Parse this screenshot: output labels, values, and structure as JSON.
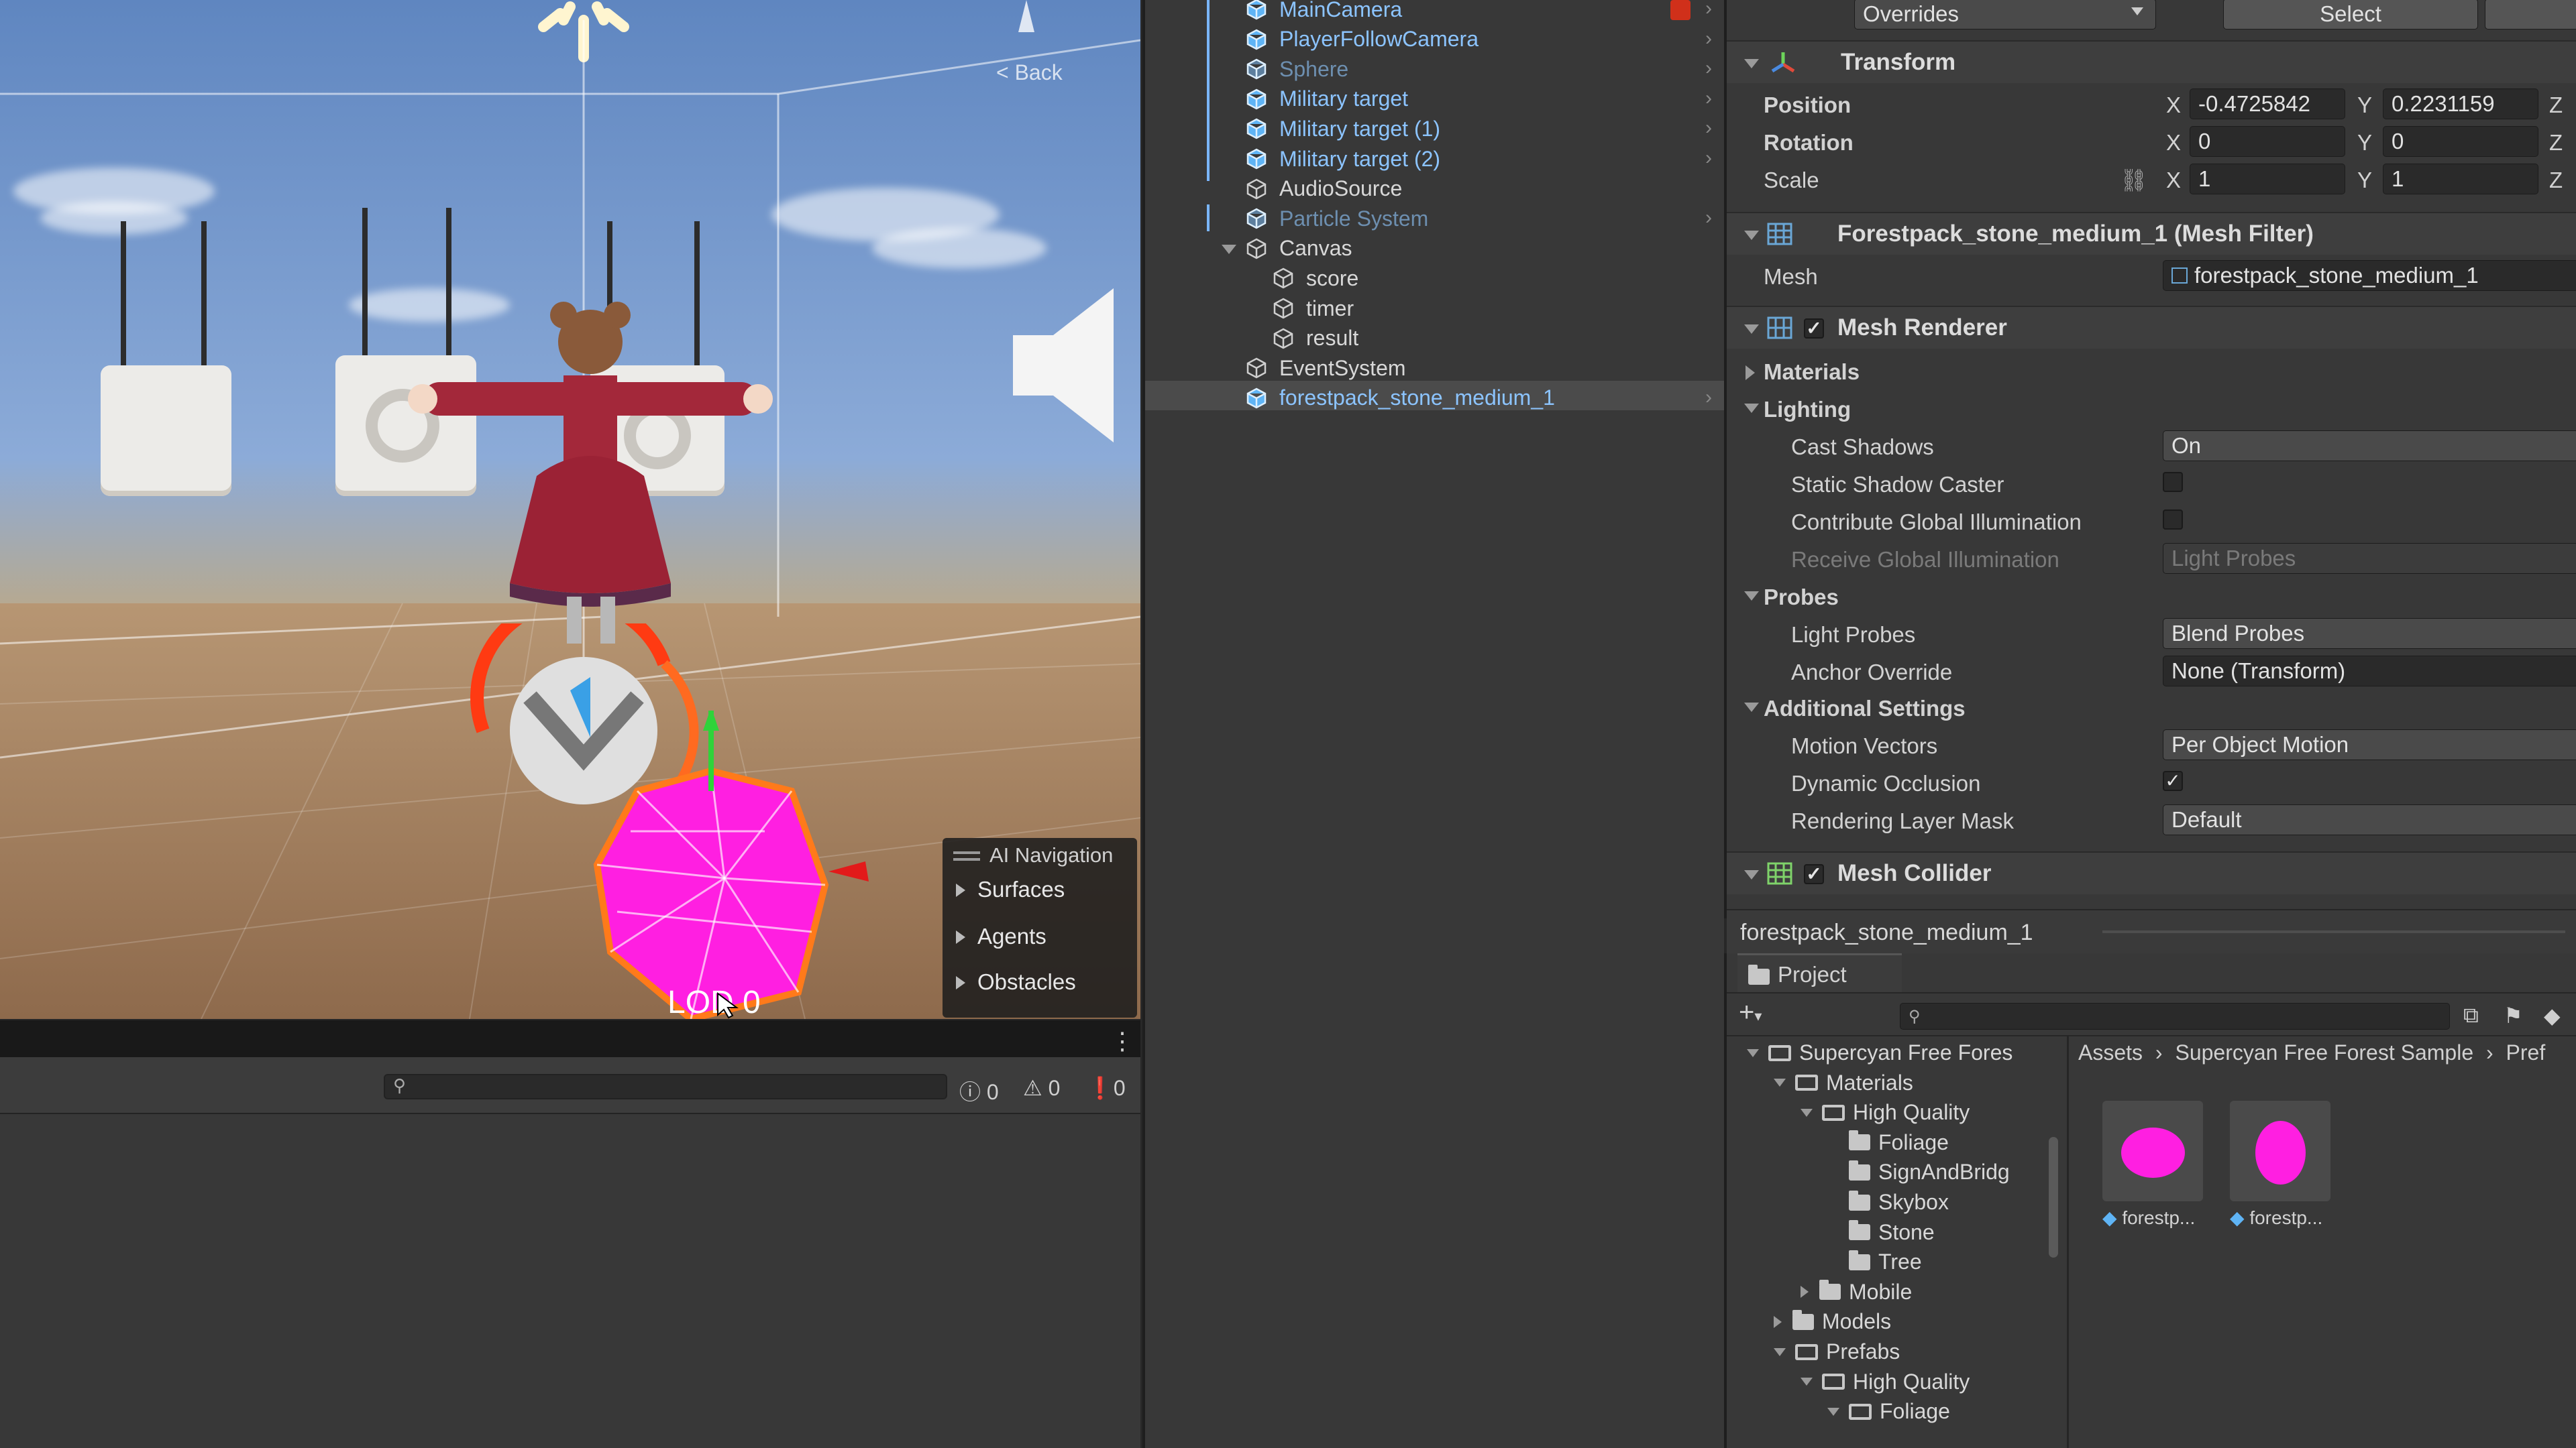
{
  "scene": {
    "back_label": "< Back",
    "lod_label": "LOD 0",
    "ai_nav": {
      "title": "AI Navigation",
      "items": [
        "Surfaces",
        "Agents",
        "Obstacles"
      ]
    }
  },
  "console": {
    "search_placeholder": "",
    "log_count": "0",
    "warning_count": "0",
    "error_count": "0"
  },
  "hierarchy": {
    "items": [
      {
        "label": "MainCamera",
        "style": "prefab"
      },
      {
        "label": "PlayerFollowCamera",
        "style": "prefab"
      },
      {
        "label": "Sphere",
        "style": "prefab-disabled"
      },
      {
        "label": "Military target",
        "style": "prefab"
      },
      {
        "label": "Military target (1)",
        "style": "prefab"
      },
      {
        "label": "Military target (2)",
        "style": "prefab"
      },
      {
        "label": "AudioSource",
        "style": "object"
      },
      {
        "label": "Particle System",
        "style": "prefab-disabled"
      },
      {
        "label": "Canvas",
        "style": "object"
      },
      {
        "label": "score",
        "style": "object"
      },
      {
        "label": "timer",
        "style": "object"
      },
      {
        "label": "result",
        "style": "object"
      },
      {
        "label": "EventSystem",
        "style": "object"
      },
      {
        "label": "forestpack_stone_medium_1",
        "style": "prefab"
      }
    ]
  },
  "inspector": {
    "overrides_label": "Overrides",
    "select_label": "Select",
    "transform": {
      "title": "Transform",
      "position_label": "Position",
      "rotation_label": "Rotation",
      "scale_label": "Scale",
      "axis_x": "X",
      "axis_y": "Y",
      "axis_z": "Z",
      "position_x": "-0.4725842",
      "position_y": "0.2231159",
      "rotation_x": "0",
      "rotation_y": "0",
      "scale_x": "1",
      "scale_y": "1"
    },
    "mesh_filter": {
      "title": "Forestpack_stone_medium_1 (Mesh Filter)",
      "mesh_label": "Mesh",
      "mesh_value": "forestpack_stone_medium_1"
    },
    "mesh_renderer": {
      "title": "Mesh Renderer",
      "materials_label": "Materials",
      "lighting_label": "Lighting",
      "cast_shadows_label": "Cast Shadows",
      "cast_shadows_value": "On",
      "static_shadow_label": "Static Shadow Caster",
      "contribute_gi_label": "Contribute Global Illumination",
      "receive_gi_label": "Receive Global Illumination",
      "receive_gi_value": "Light Probes",
      "probes_label": "Probes",
      "light_probes_label": "Light Probes",
      "light_probes_value": "Blend Probes",
      "anchor_override_label": "Anchor Override",
      "anchor_override_value": "None (Transform)",
      "additional_label": "Additional Settings",
      "motion_vectors_label": "Motion Vectors",
      "motion_vectors_value": "Per Object Motion",
      "dynamic_occlusion_label": "Dynamic Occlusion",
      "rendering_layer_label": "Rendering Layer Mask",
      "rendering_layer_value": "Default"
    },
    "mesh_collider": {
      "title": "Mesh Collider"
    },
    "footer_object": "forestpack_stone_medium_1"
  },
  "project": {
    "tab_label": "Project",
    "tree": [
      {
        "label": "Supercyan Free Fores",
        "indent": 0,
        "state": "open"
      },
      {
        "label": "Materials",
        "indent": 1,
        "state": "open"
      },
      {
        "label": "High Quality",
        "indent": 2,
        "state": "open"
      },
      {
        "label": "Foliage",
        "indent": 3,
        "state": "leaf"
      },
      {
        "label": "SignAndBridg",
        "indent": 3,
        "state": "leaf"
      },
      {
        "label": "Skybox",
        "indent": 3,
        "state": "leaf"
      },
      {
        "label": "Stone",
        "indent": 3,
        "state": "leaf"
      },
      {
        "label": "Tree",
        "indent": 3,
        "state": "leaf"
      },
      {
        "label": "Mobile",
        "indent": 2,
        "state": "closed"
      },
      {
        "label": "Models",
        "indent": 1,
        "state": "closed"
      },
      {
        "label": "Prefabs",
        "indent": 1,
        "state": "open"
      },
      {
        "label": "High Quality",
        "indent": 2,
        "state": "open"
      },
      {
        "label": "Foliage",
        "indent": 3,
        "state": "open"
      }
    ],
    "breadcrumb": [
      "Assets",
      "Supercyan Free Forest Sample",
      "Pref"
    ],
    "assets": [
      {
        "label": "forestp..."
      },
      {
        "label": "forestp..."
      }
    ]
  },
  "colors": {
    "accent_blue": "#7ab6ff",
    "prefab_cube": "#5fb4f5",
    "magenta": "#ff1fe1",
    "panel_bg": "#383838"
  }
}
